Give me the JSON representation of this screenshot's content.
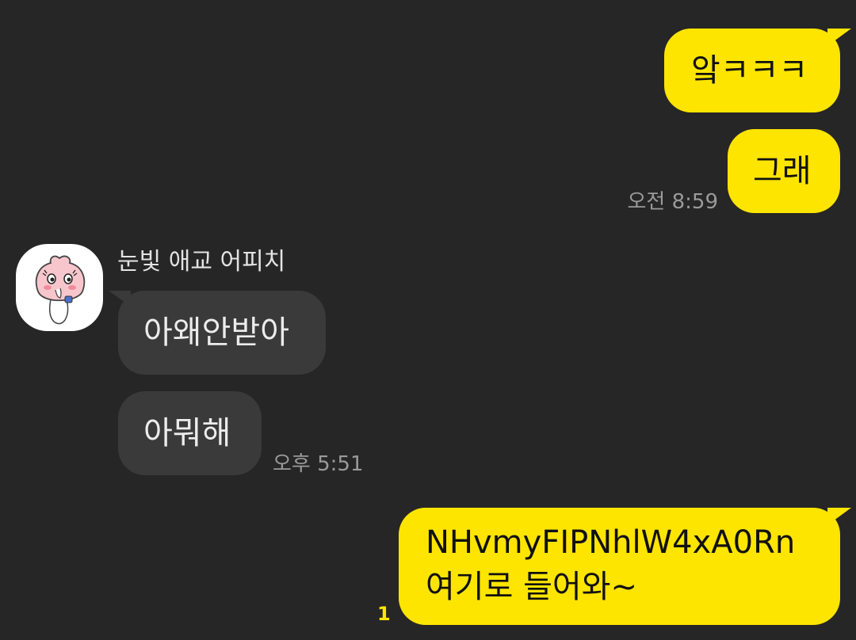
{
  "messages": {
    "out1": {
      "text": "앜ㅋㅋㅋ"
    },
    "out2": {
      "text": "그래",
      "time": "오전 8:59"
    },
    "sender": {
      "name": "눈빛 애교 어피치",
      "avatar_icon": "apeach-character-icon"
    },
    "in1": {
      "text": "아왜안받아"
    },
    "in2": {
      "text": "아뭐해",
      "time": "오후 5:51"
    },
    "out3": {
      "line1": "NHvmyFIPNhlW4xA0Rn",
      "line2": "여기로 들어와~",
      "unread": "1"
    }
  },
  "colors": {
    "background": "#262626",
    "my_bubble": "#FEE500",
    "their_bubble": "#3a3a3a",
    "unread_count": "#FEE500"
  }
}
